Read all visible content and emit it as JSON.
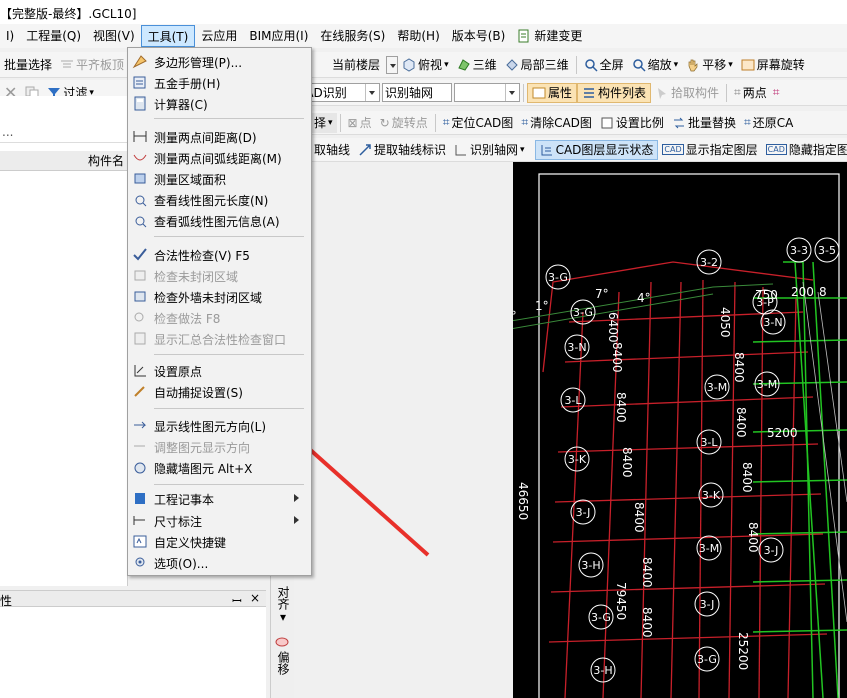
{
  "window": {
    "title": "【完整版-最终】.GCL10]"
  },
  "menubar": {
    "items": [
      "I)",
      "工程量(Q)",
      "视图(V)",
      "工具(T)",
      "云应用",
      "BIM应用(I)",
      "在线服务(S)",
      "帮助(H)",
      "版本号(B)",
      "新建变更"
    ]
  },
  "toolbar1": {
    "batch_select": "批量选择",
    "flat_board_top": "平齐板顶",
    "current_floor": "当前楼层",
    "top_view": "俯视",
    "three_d": "三维",
    "partial_3d": "局部三维",
    "full_screen": "全屏",
    "zoom": "缩放",
    "pan": "平移",
    "screen_rotate": "屏幕旋转"
  },
  "toolbar2": {
    "filter": "过滤",
    "cad_identify": "CAD识别",
    "identify_axis": "识别轴网",
    "properties": "属性",
    "component_list": "构件列表",
    "pick_component": "拾取构件",
    "two_points": "两点"
  },
  "toolbar3": {
    "select_suffix": "择",
    "point": "点",
    "rotate_point": "旋转点",
    "locate_cad": "定位CAD图",
    "clear_cad": "清除CAD图",
    "set_scale": "设置比例",
    "batch_replace": "批量替换",
    "restore_cad": "还原CA"
  },
  "toolbar4": {
    "extract_axis": "取轴线",
    "extract_axis_label": "提取轴线标识",
    "identify_axis_net": "识别轴网",
    "cad_layer_status": "CAD图层显示状态",
    "show_layer": "显示指定图层",
    "hide_layer": "隐藏指定图"
  },
  "leftpanel": {
    "search_dots": "...",
    "col_header": "构件名",
    "bottom_title": "性",
    "pin": "ꟷ",
    "close": "×"
  },
  "sidepanel": {
    "align": "对齐",
    "offset": "偏移"
  },
  "dropdown": {
    "items": [
      {
        "label": "多边形管理(P)...",
        "icon": "polygon-icon",
        "enabled": true
      },
      {
        "label": "五金手册(H)",
        "icon": "handbook-icon",
        "enabled": true
      },
      {
        "label": "计算器(C)",
        "icon": "calculator-icon",
        "enabled": true
      },
      {
        "label": "测量两点间距离(D)",
        "icon": "ruler-icon",
        "enabled": true
      },
      {
        "label": "测量两点间弧线距离(M)",
        "icon": "arc-icon",
        "enabled": true
      },
      {
        "label": "测量区域面积",
        "icon": "area-icon",
        "enabled": true
      },
      {
        "label": "查看线性图元长度(N)",
        "icon": "line-length-icon",
        "enabled": true
      },
      {
        "label": "查看弧线性图元信息(A)",
        "icon": "arc-info-icon",
        "enabled": true
      },
      {
        "label": "合法性检查(V)    F5",
        "icon": "check-icon",
        "enabled": true
      },
      {
        "label": "检查未封闭区域",
        "icon": "region-icon",
        "enabled": false
      },
      {
        "label": "检查外墙未封闭区域",
        "icon": "wall-region-icon",
        "enabled": true
      },
      {
        "label": "检查做法    F8",
        "icon": "method-icon",
        "enabled": false
      },
      {
        "label": "显示汇总合法性检查窗口",
        "icon": "summary-icon",
        "enabled": false
      },
      {
        "label": "设置原点",
        "icon": "origin-icon",
        "enabled": true
      },
      {
        "label": "自动捕捉设置(S)",
        "icon": "snap-icon",
        "enabled": true
      },
      {
        "label": "显示线性图元方向(L)",
        "icon": "direction-icon",
        "enabled": true
      },
      {
        "label": "调整图元显示方向",
        "icon": "adjust-icon",
        "enabled": false
      },
      {
        "label": "隐藏墙图元    Alt+X",
        "icon": "hide-wall-icon",
        "enabled": true
      },
      {
        "label": "工程记事本",
        "icon": "notebook-icon",
        "enabled": true,
        "submenu": true
      },
      {
        "label": "尺寸标注",
        "icon": "dimension-icon",
        "enabled": true,
        "submenu": true
      },
      {
        "label": "自定义快捷键",
        "icon": "shortcut-icon",
        "enabled": true
      },
      {
        "label": "选项(O)...",
        "icon": "options-icon",
        "enabled": true
      }
    ]
  },
  "cad": {
    "axis_labels": [
      "3-G",
      "3-2",
      "3-3",
      "3-5",
      "3-N",
      "3-P",
      "3-M",
      "3-L",
      "3-K",
      "3-J",
      "3-H",
      "3-G",
      "3-G",
      "3-N",
      "3-M",
      "3-L",
      "3-K",
      "3-J",
      "3-H",
      "3-G",
      "3-M",
      "3-J"
    ],
    "dims": [
      "8400",
      "8400",
      "8400",
      "8400",
      "8400",
      "8400",
      "8400",
      "8400",
      "8400",
      "8400",
      "6400",
      "4050",
      "46650",
      "79450",
      "25200",
      "5200",
      "750",
      "200",
      "8",
      "1°",
      "1°",
      "7°",
      "4°"
    ]
  },
  "colors": {
    "accent": "#4a90d9",
    "highlight": "#d5e8fb",
    "arrow": "#e8302a"
  }
}
